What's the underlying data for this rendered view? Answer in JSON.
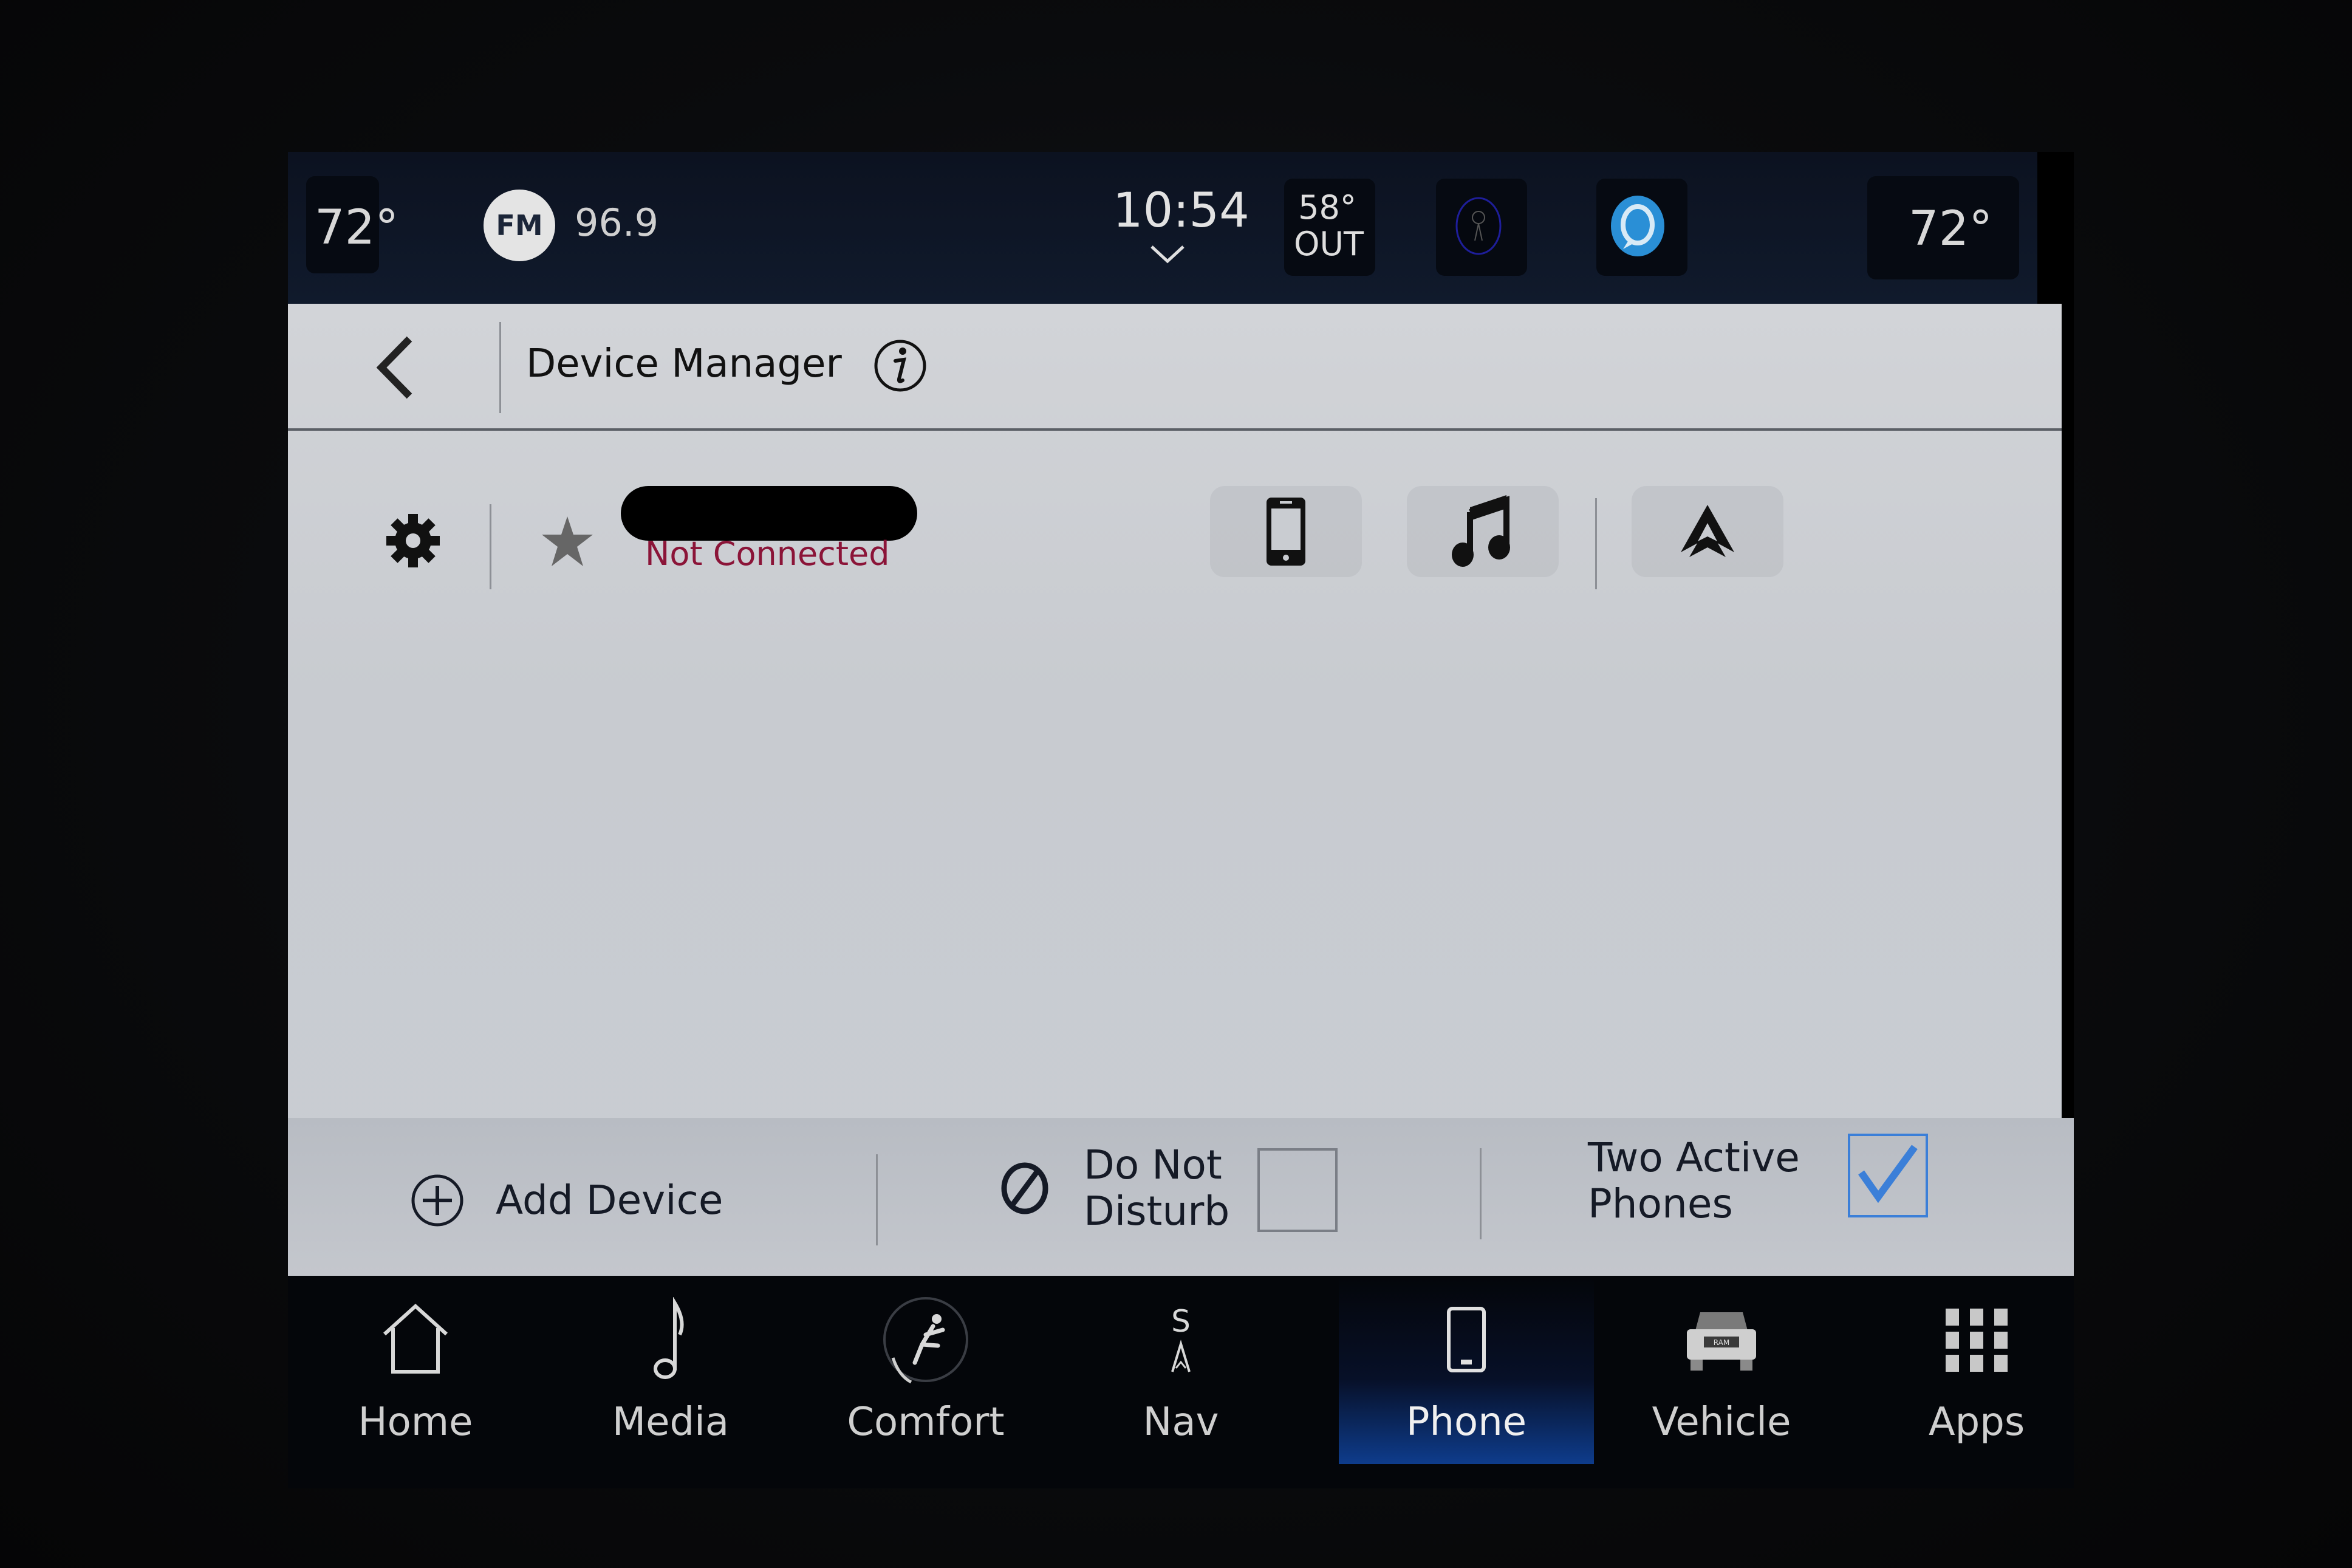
{
  "status_bar": {
    "driver_temp": "72°",
    "radio_band": "FM",
    "radio_frequency": "96.9",
    "clock": "10:54",
    "outside_temp": "58°",
    "outside_label": "OUT",
    "passenger_temp": "72°",
    "icons": [
      "chevron-down-icon",
      "voice-assistant-icon",
      "alexa-icon"
    ]
  },
  "header": {
    "title": "Device Manager",
    "back_icon": "chevron-left-icon",
    "info_icon": "info-icon"
  },
  "device": {
    "name": "[redacted]",
    "status": "Not Connected",
    "status_color": "#8b1438",
    "settings_icon": "gear-icon",
    "favorite_icon": "star-icon",
    "services": [
      {
        "name": "phone",
        "icon": "smartphone-icon"
      },
      {
        "name": "audio",
        "icon": "music-note-icon"
      },
      {
        "name": "android-auto",
        "icon": "android-auto-icon"
      }
    ]
  },
  "actions": {
    "add_device": "Add Device",
    "do_not_disturb_line1": "Do Not",
    "do_not_disturb_line2": "Disturb",
    "do_not_disturb_checked": false,
    "two_active_phones_line1": "Two Active",
    "two_active_phones_line2": "Phones",
    "two_active_phones_checked": true,
    "accent_color": "#3b7fd8"
  },
  "nav": {
    "items": [
      {
        "label": "Home",
        "icon": "home-icon",
        "active": false
      },
      {
        "label": "Media",
        "icon": "music-note-icon",
        "active": false
      },
      {
        "label": "Comfort",
        "icon": "seat-icon",
        "active": false
      },
      {
        "label": "Nav",
        "icon": "compass-icon",
        "compass_heading": "S",
        "active": false
      },
      {
        "label": "Phone",
        "icon": "smartphone-icon",
        "active": true
      },
      {
        "label": "Vehicle",
        "icon": "truck-icon",
        "active": false
      },
      {
        "label": "Apps",
        "icon": "grid-icon",
        "active": false
      }
    ]
  }
}
